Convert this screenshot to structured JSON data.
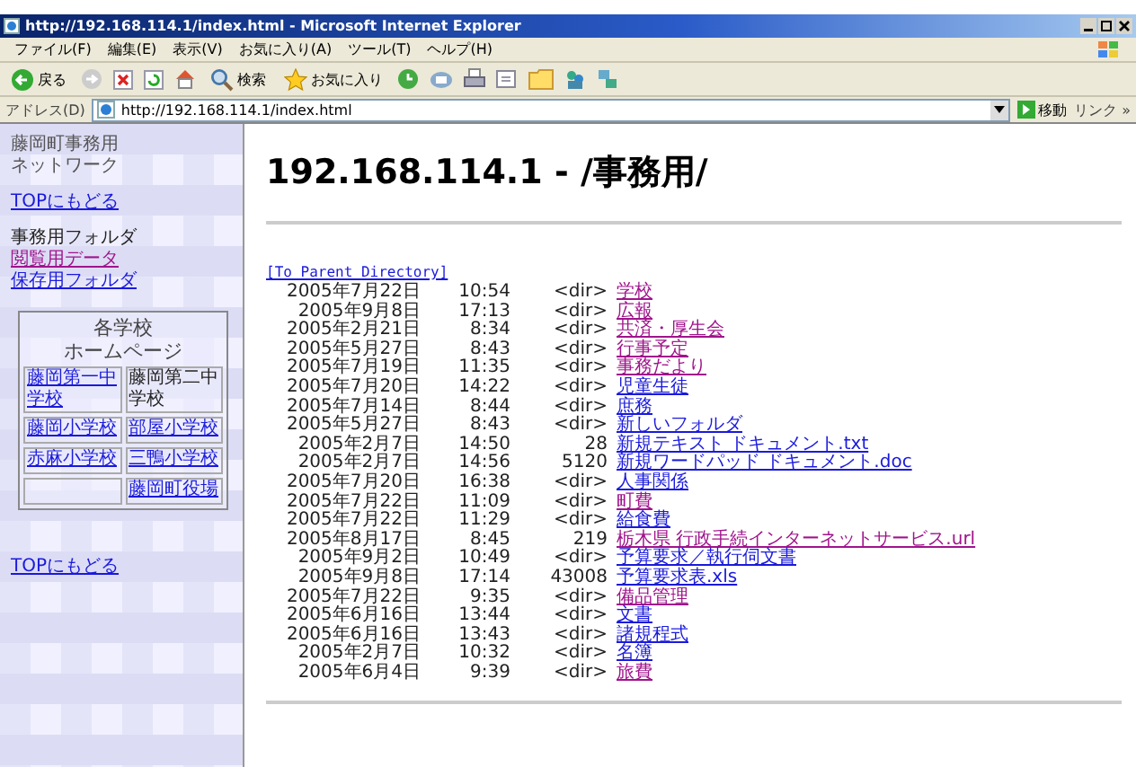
{
  "window": {
    "title": "http://192.168.114.1/index.html - Microsoft Internet Explorer"
  },
  "menu": [
    "ファイル(F)",
    "編集(E)",
    "表示(V)",
    "お気に入り(A)",
    "ツール(T)",
    "ヘルプ(H)"
  ],
  "toolbar": {
    "back": "戻る",
    "search": "検索",
    "favorites": "お気に入り"
  },
  "address": {
    "label": "アドレス(D)",
    "value": "http://192.168.114.1/index.html",
    "go": "移動",
    "links": "リンク »"
  },
  "sidebar": {
    "title_lines": [
      "藤岡町事務用",
      "ネットワーク"
    ],
    "top_link": "TOPにもどる",
    "folder_heading": "事務用フォルダ",
    "folder_links": [
      {
        "label": "閲覧用データ",
        "visited": true
      },
      {
        "label": "保存用フォルダ",
        "visited": false
      }
    ],
    "schools": {
      "heading_lines": [
        "各学校",
        "ホームページ"
      ],
      "cells": [
        {
          "kind": "link",
          "label": "藤岡第一中学校"
        },
        {
          "kind": "text",
          "label": "藤岡第二中学校"
        },
        {
          "kind": "link",
          "label": "藤岡小学校"
        },
        {
          "kind": "link",
          "label": "部屋小学校"
        },
        {
          "kind": "link",
          "label": "赤麻小学校"
        },
        {
          "kind": "link",
          "label": "三鴨小学校"
        },
        {
          "kind": "empty"
        },
        {
          "kind": "link",
          "label": "藤岡町役場"
        }
      ]
    },
    "bottom_link": "TOPにもどる"
  },
  "page": {
    "heading": "192.168.114.1 - /事務用/",
    "parent_link": "[To Parent Directory]",
    "entries": [
      {
        "date": "2005年7月22日",
        "time": "10:54",
        "size": "<dir>",
        "name": "学校",
        "visited": true
      },
      {
        "date": "2005年9月8日",
        "time": "17:13",
        "size": "<dir>",
        "name": "広報",
        "visited": true
      },
      {
        "date": "2005年2月21日",
        "time": "8:34",
        "size": "<dir>",
        "name": "共済・厚生会",
        "visited": true
      },
      {
        "date": "2005年5月27日",
        "time": "8:43",
        "size": "<dir>",
        "name": "行事予定",
        "visited": true
      },
      {
        "date": "2005年7月19日",
        "time": "11:35",
        "size": "<dir>",
        "name": "事務だより",
        "visited": true
      },
      {
        "date": "2005年7月20日",
        "time": "14:22",
        "size": "<dir>",
        "name": "児童生徒",
        "visited": false
      },
      {
        "date": "2005年7月14日",
        "time": "8:44",
        "size": "<dir>",
        "name": "庶務",
        "visited": false
      },
      {
        "date": "2005年5月27日",
        "time": "8:43",
        "size": "<dir>",
        "name": "新しいフォルダ",
        "visited": false
      },
      {
        "date": "2005年2月7日",
        "time": "14:50",
        "size": "28",
        "name": "新規テキスト ドキュメント.txt",
        "visited": false
      },
      {
        "date": "2005年2月7日",
        "time": "14:56",
        "size": "5120",
        "name": "新規ワードパッド ドキュメント.doc",
        "visited": false
      },
      {
        "date": "2005年7月20日",
        "time": "16:38",
        "size": "<dir>",
        "name": "人事関係",
        "visited": false
      },
      {
        "date": "2005年7月22日",
        "time": "11:09",
        "size": "<dir>",
        "name": "町費",
        "visited": true
      },
      {
        "date": "2005年7月22日",
        "time": "11:29",
        "size": "<dir>",
        "name": "給食費",
        "visited": false
      },
      {
        "date": "2005年8月17日",
        "time": "8:45",
        "size": "219",
        "name": "栃木県 行政手続インターネットサービス.url",
        "visited": true
      },
      {
        "date": "2005年9月2日",
        "time": "10:49",
        "size": "<dir>",
        "name": "予算要求／執行伺文書",
        "visited": false
      },
      {
        "date": "2005年9月8日",
        "time": "17:14",
        "size": "43008",
        "name": "予算要求表.xls",
        "visited": false
      },
      {
        "date": "2005年7月22日",
        "time": "9:35",
        "size": "<dir>",
        "name": "備品管理",
        "visited": true
      },
      {
        "date": "2005年6月16日",
        "time": "13:44",
        "size": "<dir>",
        "name": "文書",
        "visited": false
      },
      {
        "date": "2005年6月16日",
        "time": "13:43",
        "size": "<dir>",
        "name": "諸規程式",
        "visited": false
      },
      {
        "date": "2005年2月7日",
        "time": "10:32",
        "size": "<dir>",
        "name": "名簿",
        "visited": false
      },
      {
        "date": "2005年6月4日",
        "time": "9:39",
        "size": "<dir>",
        "name": "旅費",
        "visited": true
      }
    ]
  }
}
